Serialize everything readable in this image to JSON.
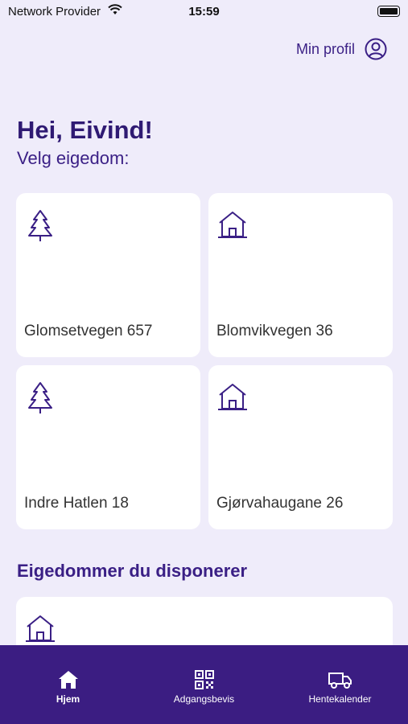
{
  "status": {
    "carrier": "Network Provider",
    "time": "15:59"
  },
  "header": {
    "profile_label": "Min profil"
  },
  "greeting": "Hei, Eivind!",
  "subtitle": "Velg eigedom:",
  "properties": [
    {
      "label": "Glomsetvegen 657",
      "icon": "tree-icon"
    },
    {
      "label": "Blomvikvegen 36",
      "icon": "house-icon"
    },
    {
      "label": "Indre Hatlen 18",
      "icon": "tree-icon"
    },
    {
      "label": "Gjørvahaugane 26",
      "icon": "house-icon"
    }
  ],
  "section_title": "Eigedommer du disponerer",
  "tabs": [
    {
      "label": "Hjem",
      "icon": "home-icon",
      "active": true
    },
    {
      "label": "Adgangsbevis",
      "icon": "qr-code-icon",
      "active": false
    },
    {
      "label": "Hentekalender",
      "icon": "truck-icon",
      "active": false
    }
  ],
  "colors": {
    "background": "#efecfa",
    "accent": "#3a1f85",
    "tab_bar": "#3b1d82"
  }
}
